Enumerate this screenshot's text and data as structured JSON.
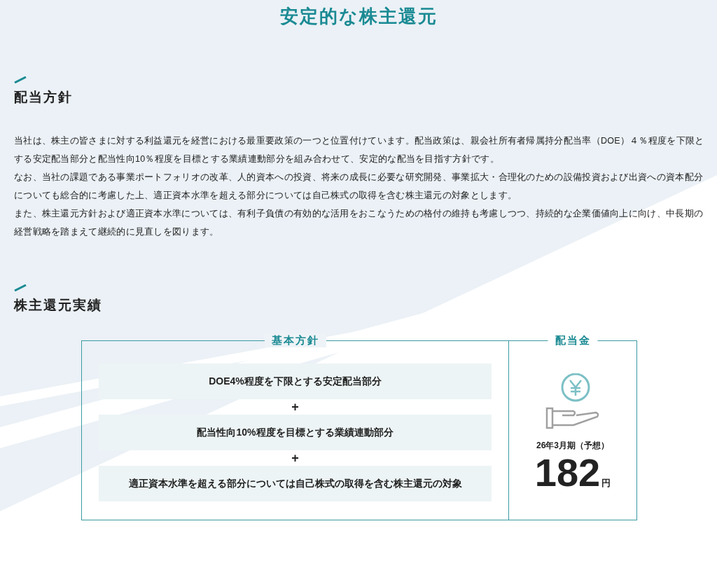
{
  "page_title": "安定的な株主還元",
  "policy": {
    "heading": "配当方針",
    "paragraphs": [
      "当社は、株主の皆さまに対する利益還元を経営における最重要政策の一つと位置付けています。配当政策は、親会社所有者帰属持分配当率（DOE）４％程度を下限とする安定配当部分と配当性向10％程度を目標とする業績連動部分を組み合わせて、安定的な配当を目指す方針です。",
      "なお、当社の課題である事業ポートフォリオの改革、人的資本への投資、将来の成長に必要な研究開発、事業拡大・合理化のための設備投資および出資への資本配分についても総合的に考慮した上、適正資本水準を超える部分については自己株式の取得を含む株主還元の対象とします。",
      "また、株主還元方針および適正資本水準については、有利子負債の有効的な活用をおこなうための格付の維持も考慮しつつ、持続的な企業価値向上に向け、中長期の経営戦略を踏まえて継続的に見直しを図ります。"
    ]
  },
  "results": {
    "heading": "株主還元実績",
    "basic_policy": {
      "label": "基本方針",
      "items": [
        "DOE4%程度を下限とする安定配当部分",
        "配当性向10%程度を目標とする業績連動部分",
        "適正資本水準を超える部分については自己株式の取得を含む株主還元の対象"
      ],
      "separator": "+"
    },
    "dividend": {
      "label": "配当金",
      "period": "26年3月期（予想）",
      "amount": "182",
      "unit": "円"
    }
  }
}
